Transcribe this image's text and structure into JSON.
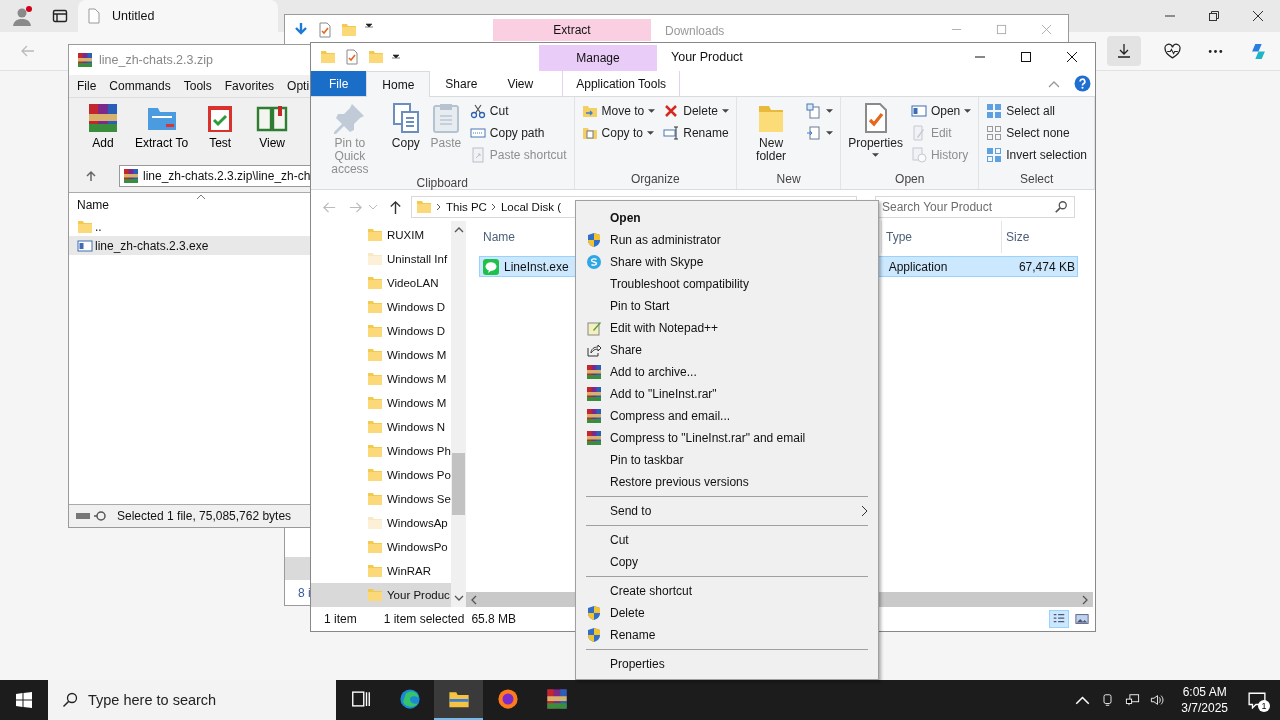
{
  "browser": {
    "tab_title": "Untitled"
  },
  "downloads_window": {
    "context_tab": "Extract",
    "title": "Downloads",
    "status_fragment": "8 i"
  },
  "winrar": {
    "title": "line_zh-chats.2.3.zip",
    "menu": [
      "File",
      "Commands",
      "Tools",
      "Favorites",
      "Opti"
    ],
    "toolbar": [
      {
        "label": "Add",
        "kind": "add"
      },
      {
        "label": "Extract To",
        "kind": "extract"
      },
      {
        "label": "Test",
        "kind": "test"
      },
      {
        "label": "View",
        "kind": "view"
      }
    ],
    "path": "line_zh-chats.2.3.zip\\line_zh-ch",
    "column": "Name",
    "rows": [
      {
        "name": "..",
        "kind": "folder",
        "selected": false
      },
      {
        "name": "line_zh-chats.2.3.exe",
        "kind": "exe",
        "selected": true
      }
    ],
    "status": "Selected 1 file, 75,085,762 bytes"
  },
  "explorer": {
    "context_tab": "Manage",
    "title": "Your Product",
    "tabs": [
      {
        "label": "File",
        "kind": "file",
        "selected": false
      },
      {
        "label": "Home",
        "kind": "tab",
        "selected": true
      },
      {
        "label": "Share",
        "kind": "tab",
        "selected": false
      },
      {
        "label": "View",
        "kind": "tab",
        "selected": false
      },
      {
        "label": "Application Tools",
        "kind": "context",
        "selected": false
      }
    ],
    "ribbon": [
      {
        "label": "Clipboard",
        "columns": [
          [
            {
              "label": "Pin to Quick access",
              "kind": "pin",
              "dropdown": false,
              "disabled": true
            }
          ],
          [
            {
              "label": "Copy",
              "kind": "copy",
              "dropdown": false,
              "disabled": false
            }
          ],
          [
            {
              "label": "Paste",
              "kind": "paste",
              "dropdown": false,
              "disabled": true
            }
          ],
          [
            {
              "label": "Cut",
              "kind": "cut",
              "dropdown": false,
              "disabled": false
            },
            {
              "label": "Copy path",
              "kind": "copypath",
              "dropdown": false,
              "disabled": false
            },
            {
              "label": "Paste shortcut",
              "kind": "shortcut",
              "dropdown": false,
              "disabled": true
            }
          ]
        ]
      },
      {
        "label": "Organize",
        "columns": [
          [
            {
              "label": "Move to",
              "kind": "moveto",
              "dropdown": true,
              "disabled": false
            },
            {
              "label": "Copy to",
              "kind": "copyto",
              "dropdown": true,
              "disabled": false
            }
          ],
          [
            {
              "label": "Delete",
              "kind": "delete",
              "dropdown": true,
              "disabled": false
            },
            {
              "label": "Rename",
              "kind": "rename",
              "dropdown": false,
              "disabled": false
            }
          ]
        ]
      },
      {
        "label": "New",
        "columns": [
          [
            {
              "label": "New folder",
              "kind": "newfolder",
              "dropdown": false,
              "disabled": false
            }
          ],
          [
            {
              "kind": "newitem",
              "dropdown": true,
              "disabled": false
            },
            {
              "kind": "easyaccess",
              "dropdown": true,
              "disabled": false
            }
          ]
        ]
      },
      {
        "label": "Open",
        "columns": [
          [
            {
              "label": "Properties",
              "kind": "properties",
              "dropdown": true,
              "disabled": false
            }
          ],
          [
            {
              "label": "Open",
              "kind": "open",
              "dropdown": true,
              "disabled": false
            },
            {
              "label": "Edit",
              "kind": "edit",
              "dropdown": false,
              "disabled": true
            },
            {
              "label": "History",
              "kind": "history",
              "dropdown": false,
              "disabled": true
            }
          ]
        ]
      },
      {
        "label": "Select",
        "columns": [
          [
            {
              "label": "Select all",
              "kind": "selectall",
              "dropdown": false,
              "disabled": false
            },
            {
              "label": "Select none",
              "kind": "selectnone",
              "dropdown": false,
              "disabled": false
            },
            {
              "label": "Invert selection",
              "kind": "invert",
              "dropdown": false,
              "disabled": false
            }
          ]
        ]
      }
    ],
    "breadcrumb": [
      "This PC",
      "Local Disk ("
    ],
    "search_placeholder": "Search Your Product",
    "nav": [
      {
        "label": "RUXIM",
        "faded": false,
        "selected": false
      },
      {
        "label": "Uninstall Inf",
        "faded": true,
        "selected": false
      },
      {
        "label": "VideoLAN",
        "faded": false,
        "selected": false
      },
      {
        "label": "Windows D",
        "faded": false,
        "selected": false
      },
      {
        "label": "Windows D",
        "faded": false,
        "selected": false
      },
      {
        "label": "Windows M",
        "faded": false,
        "selected": false
      },
      {
        "label": "Windows M",
        "faded": false,
        "selected": false
      },
      {
        "label": "Windows M",
        "faded": false,
        "selected": false
      },
      {
        "label": "Windows N",
        "faded": false,
        "selected": false
      },
      {
        "label": "Windows Ph",
        "faded": false,
        "selected": false
      },
      {
        "label": "Windows Po",
        "faded": false,
        "selected": false
      },
      {
        "label": "Windows Se",
        "faded": false,
        "selected": false
      },
      {
        "label": "WindowsAp",
        "faded": true,
        "selected": false
      },
      {
        "label": "WindowsPo",
        "faded": false,
        "selected": false
      },
      {
        "label": "WinRAR",
        "faded": false,
        "selected": false
      },
      {
        "label": "Your Produc",
        "faded": false,
        "selected": true
      }
    ],
    "columns": [
      "Name",
      "Type",
      "Size"
    ],
    "files": [
      {
        "name": "LineInst.exe",
        "type": "Application",
        "size": "67,474 KB",
        "selected": true
      }
    ],
    "status": {
      "count": "1 item",
      "selection": "1 item selected",
      "size": "65.8 MB"
    },
    "views": [
      {
        "kind": "details",
        "selected": true
      },
      {
        "kind": "large",
        "selected": false
      }
    ]
  },
  "context_menu": [
    [
      {
        "label": "Open",
        "kind": "plain",
        "default": true,
        "submenu": false
      },
      {
        "label": "Run as administrator",
        "kind": "shield",
        "default": false,
        "submenu": false
      },
      {
        "label": "Share with Skype",
        "kind": "skype",
        "default": false,
        "submenu": false
      },
      {
        "label": "Troubleshoot compatibility",
        "kind": "plain",
        "default": false,
        "submenu": false
      },
      {
        "label": "Pin to Start",
        "kind": "plain",
        "default": false,
        "submenu": false
      },
      {
        "label": "Edit with Notepad++",
        "kind": "notepad",
        "default": false,
        "submenu": false
      },
      {
        "label": "Share",
        "kind": "share",
        "default": false,
        "submenu": false
      },
      {
        "label": "Add to archive...",
        "kind": "winrar",
        "default": false,
        "submenu": false
      },
      {
        "label": "Add to \"LineInst.rar\"",
        "kind": "winrar",
        "default": false,
        "submenu": false
      },
      {
        "label": "Compress and email...",
        "kind": "winrar",
        "default": false,
        "submenu": false
      },
      {
        "label": "Compress to \"LineInst.rar\" and email",
        "kind": "winrar",
        "default": false,
        "submenu": false
      },
      {
        "label": "Pin to taskbar",
        "kind": "plain",
        "default": false,
        "submenu": false
      },
      {
        "label": "Restore previous versions",
        "kind": "plain",
        "default": false,
        "submenu": false
      }
    ],
    [
      {
        "label": "Send to",
        "kind": "plain",
        "default": false,
        "submenu": true
      }
    ],
    [
      {
        "label": "Cut",
        "kind": "plain",
        "default": false,
        "submenu": false
      },
      {
        "label": "Copy",
        "kind": "plain",
        "default": false,
        "submenu": false
      }
    ],
    [
      {
        "label": "Create shortcut",
        "kind": "plain",
        "default": false,
        "submenu": false
      },
      {
        "label": "Delete",
        "kind": "shield",
        "default": false,
        "submenu": false
      },
      {
        "label": "Rename",
        "kind": "shield",
        "default": false,
        "submenu": false
      }
    ],
    [
      {
        "label": "Properties",
        "kind": "plain",
        "default": false,
        "submenu": false
      }
    ]
  ],
  "taskbar": {
    "search_placeholder": "Type here to search",
    "apps": [
      {
        "kind": "taskview",
        "selected": false
      },
      {
        "kind": "edge",
        "selected": false
      },
      {
        "kind": "explorer",
        "selected": true
      },
      {
        "kind": "firefox",
        "selected": false
      },
      {
        "kind": "winrar",
        "selected": false
      }
    ],
    "time": "6:05 AM",
    "date": "3/7/2025",
    "notifications": "1"
  }
}
